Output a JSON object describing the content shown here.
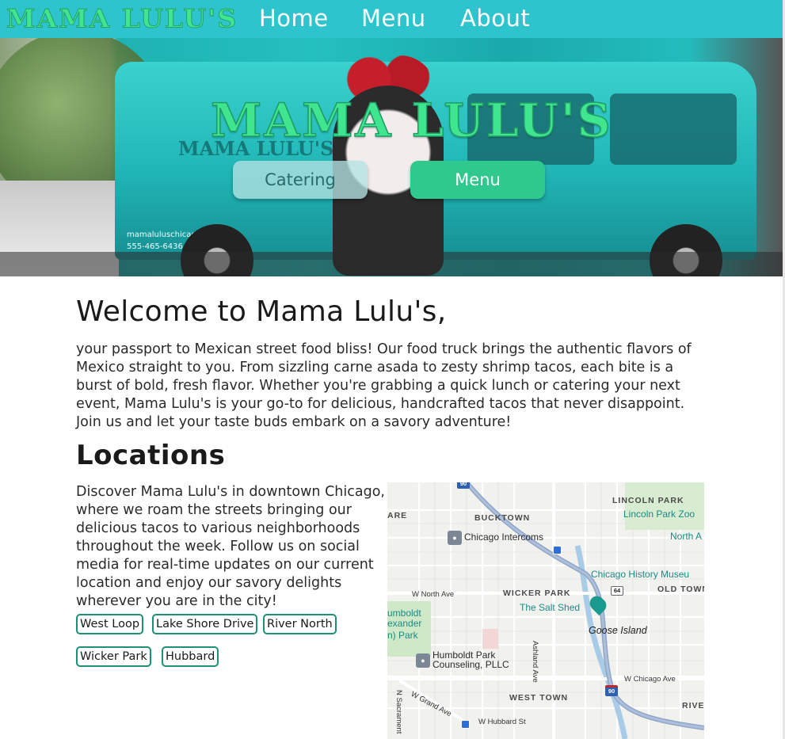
{
  "nav": {
    "logo": "MAMA LULU'S",
    "links": [
      "Home",
      "Menu",
      "About"
    ]
  },
  "hero": {
    "title": "MAMA LULU'S",
    "buttons": {
      "catering": "Catering",
      "menu": "Menu"
    },
    "truck_text": {
      "logo": "MAMA LULU'S",
      "url": "mamaluluschicago.com",
      "phone": "555-465-6436"
    }
  },
  "welcome": {
    "heading": "Welcome to Mama Lulu's,",
    "body": "your passport to Mexican street food bliss! Our food truck brings the authentic flavors of Mexico straight to you. From sizzling carne asada to zesty shrimp tacos, each bite is a burst of bold, fresh flavor. Whether you're grabbing a quick lunch or catering your next event, Mama Lulu's is your go-to for delicious, handcrafted tacos that never disappoint. Join us and let your taste buds embark on a savory adventure!"
  },
  "locations": {
    "heading": "Locations",
    "body": "Discover Mama Lulu's in downtown Chicago, where we roam the streets bringing our delicious tacos to various neighborhoods throughout the week. Follow us on social media for real-time updates on our current location and enjoy our savory delights wherever you are in the city!",
    "tags": [
      "West Loop",
      "Lake Shore Drive",
      "River North",
      "Wicker Park",
      "Hubbard"
    ]
  },
  "map": {
    "districts": [
      "LINCOLN PARK",
      "BUCKTOWN",
      "WICKER PARK",
      "OLD TOWN",
      "WEST TOWN",
      "RIVE",
      "ARE"
    ],
    "places": [
      "Chicago Intercoms",
      "Lincoln Park Zoo",
      "North A",
      "Chicago History Museu",
      "The Salt Shed",
      "Humboldt Park Counseling, PLLC",
      "Goose Island"
    ],
    "park_lines": [
      "umboldt",
      "exander",
      "n) Park"
    ],
    "streets": [
      "W North Ave",
      "Ashland Ave",
      "W Chicago Ave",
      "W Grand Ave",
      "W Hubbard St",
      "N Sacrament"
    ],
    "highway_shields": [
      "90",
      "64",
      "90"
    ]
  }
}
